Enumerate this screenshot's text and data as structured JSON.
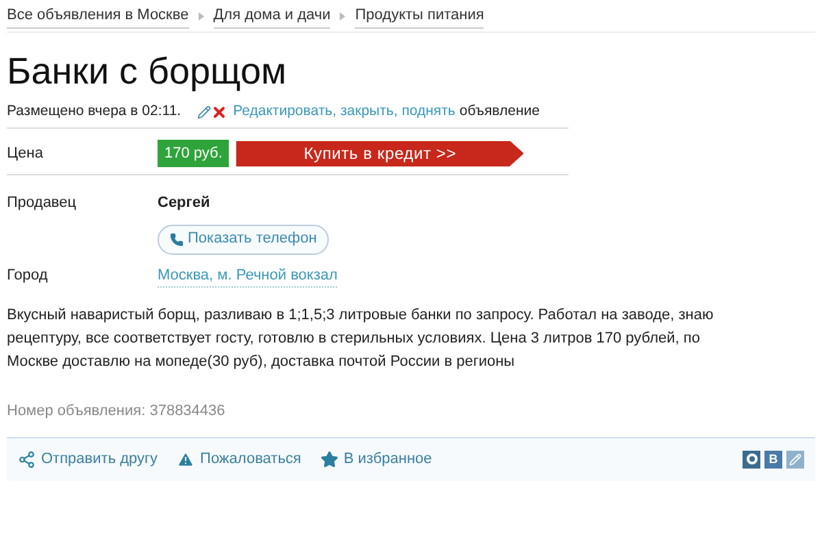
{
  "breadcrumbs": [
    "Все объявления в Москве",
    "Для дома и дачи",
    "Продукты питания"
  ],
  "title": "Банки с борщом",
  "posted": {
    "text": "Размещено вчера в 02:11.",
    "actions": "Редактировать, закрыть, поднять",
    "suffix": "объявление"
  },
  "price": {
    "label": "Цена",
    "value": "170 руб.",
    "credit_button": "Купить в кредит >>"
  },
  "seller": {
    "label": "Продавец",
    "name": "Сергей",
    "phone_button": "Показать телефон"
  },
  "city": {
    "label": "Город",
    "value": "Москва, м. Речной вокзал"
  },
  "description": "Вкусный наваристый борщ, разливаю в 1;1,5;3 литровые банки по запросу. Работал на заводе, знаю рецептуру, все соответствует госту, готовлю в стерильных условиях. Цена 3 литров 170 рублей, по Москве доставлю на мопеде(30 руб), доставка почтой России в регионы",
  "ad_number": "Номер объявления: 378834436",
  "footer_actions": [
    {
      "kind": "share",
      "label": "Отправить другу"
    },
    {
      "kind": "report",
      "label": "Пожаловаться"
    },
    {
      "kind": "favorite",
      "label": "В избранное"
    }
  ],
  "social": [
    {
      "kind": "circle"
    },
    {
      "kind": "letter",
      "label": "В"
    },
    {
      "kind": "pencil"
    }
  ]
}
